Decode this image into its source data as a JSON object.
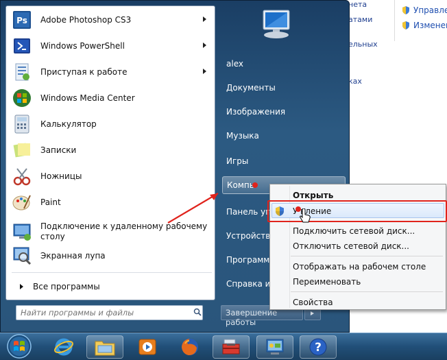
{
  "background_window": {
    "fragments": [
      "нета",
      "атами",
      "ельных",
      "ках"
    ],
    "links": [
      "Управле",
      "Изменен"
    ]
  },
  "pinned_programs": [
    {
      "label": "Adobe Photoshop CS3",
      "has_submenu": true,
      "icon": "photoshop-icon"
    },
    {
      "label": "Windows PowerShell",
      "has_submenu": true,
      "icon": "powershell-icon"
    },
    {
      "label": "Приступая к работе",
      "has_submenu": true,
      "icon": "getting-started-icon"
    },
    {
      "label": "Windows Media Center",
      "has_submenu": false,
      "icon": "media-center-icon"
    },
    {
      "label": "Калькулятор",
      "has_submenu": false,
      "icon": "calculator-icon"
    },
    {
      "label": "Записки",
      "has_submenu": false,
      "icon": "sticky-notes-icon"
    },
    {
      "label": "Ножницы",
      "has_submenu": false,
      "icon": "snipping-tool-icon"
    },
    {
      "label": "Paint",
      "has_submenu": false,
      "icon": "paint-icon"
    },
    {
      "label_line1": "Подключение к удаленному рабочему",
      "label_line2": "столу",
      "has_submenu": false,
      "icon": "remote-desktop-icon"
    },
    {
      "label": "Экранная лупа",
      "has_submenu": false,
      "icon": "magnifier-icon"
    }
  ],
  "all_programs_label": "Все программы",
  "search": {
    "placeholder": "Найти программы и файлы"
  },
  "right_pane": {
    "user": "alex",
    "items": [
      "Документы",
      "Изображения",
      "Музыка",
      "Игры",
      "Компьютер",
      "Панель управления",
      "Устройства и принтеры",
      "Программы по умолчанию",
      "Справка и поддержка"
    ],
    "visible_labels": [
      "alex",
      "Документы",
      "Изображения",
      "Музыка",
      "Игры",
      "Компь",
      "Панель упр",
      "Устройства",
      "Программы",
      "Справка и п"
    ]
  },
  "shutdown_label": "Завершение работы",
  "context_menu": {
    "items": [
      {
        "label": "Открыть",
        "bold": true
      },
      {
        "label": "Управление",
        "shield": true,
        "visible": "У    вление"
      },
      {
        "label": "Подключить сетевой диск..."
      },
      {
        "label": "Отключить сетевой диск..."
      },
      {
        "label": "Отображать на рабочем столе"
      },
      {
        "label": "Переименовать"
      },
      {
        "label": "Свойства"
      }
    ]
  },
  "taskbar": {
    "buttons": [
      "start-orb",
      "internet-explorer-icon",
      "explorer-folder-icon",
      "media-player-icon",
      "firefox-icon",
      "toolbox-icon",
      "control-panel-icon",
      "help-icon"
    ]
  },
  "colors": {
    "menu_blue": "#2c5a82",
    "highlight_red": "#e0231c",
    "context_highlight": "#dbe9fb"
  }
}
